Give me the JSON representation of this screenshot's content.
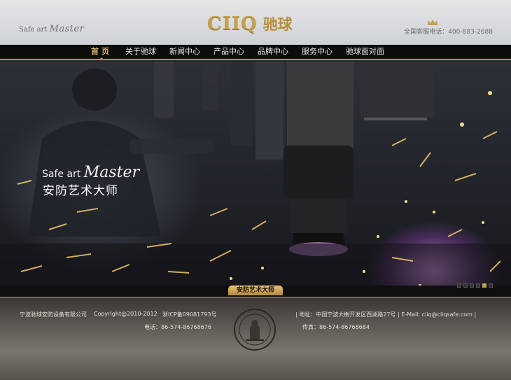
{
  "header": {
    "tagline_prefix": "Safe art",
    "tagline_script": "Master",
    "logo_en": "CIIQ",
    "logo_cn": "驰球",
    "hotline": "全国客服电话：400-883-2688"
  },
  "nav": {
    "items": [
      {
        "label": "首页",
        "active": true
      },
      {
        "label": "关于驰球",
        "active": false
      },
      {
        "label": "新闻中心",
        "active": false
      },
      {
        "label": "产品中心",
        "active": false
      },
      {
        "label": "品牌中心",
        "active": false
      },
      {
        "label": "服务中心",
        "active": false
      },
      {
        "label": "驰球面对面",
        "active": false
      }
    ]
  },
  "hero": {
    "slogan_prefix": "Safe art",
    "slogan_script": "Master",
    "slogan_cn": "安防艺术大师",
    "tab_label": "安防艺术大师",
    "slide_count": 6,
    "active_slide": 5
  },
  "footer": {
    "company": "宁波驰球安防设备有限公司",
    "copyright": "Copyright@2010-2012",
    "icp": "浙ICP备09081793号",
    "phone": "电话：86-574-86768676",
    "address": "|  地址：中国宁波大榭开发区西湖路27号  |  E-Mail: ciiq@ciiqsafe.com  |",
    "fax": "传真：86-574-86768684"
  },
  "colors": {
    "accent_gold": "#c9a14f",
    "nav_bg": "#0c0c0c",
    "header_bg": "#d9dcdf"
  }
}
